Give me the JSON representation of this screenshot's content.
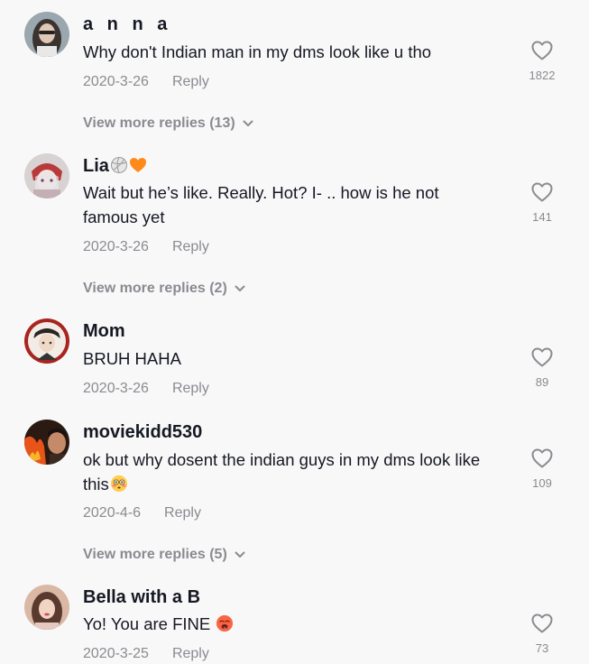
{
  "comments": [
    {
      "username": "a n n a",
      "text": "Why don't Indian man in my dms look like u tho",
      "emoji": "",
      "date": "2020-3-26",
      "reply_label": "Reply",
      "likes": "1822",
      "view_more": "View more replies (13)"
    },
    {
      "username": "Lia",
      "username_emoji": "volleyball-icon orange-heart-icon",
      "text": "Wait but he’s like. Really. Hot? I- .. how is he not famous yet",
      "emoji": "",
      "date": "2020-3-26",
      "reply_label": "Reply",
      "likes": "141",
      "view_more": "View more replies (2)"
    },
    {
      "username": "Mom",
      "text": "BRUH HAHA",
      "emoji": "",
      "date": "2020-3-26",
      "reply_label": "Reply",
      "likes": "89",
      "view_more": ""
    },
    {
      "username": "moviekidd530",
      "text": "ok but why dosent the indian guys in my dms look like this",
      "emoji": "flushed-face-icon",
      "date": "2020-4-6",
      "reply_label": "Reply",
      "likes": "109",
      "view_more": "View more replies (5)"
    },
    {
      "username": "Bella with a B",
      "text": "Yo! You are FINE",
      "emoji": "hot-face-icon",
      "date": "2020-3-25",
      "reply_label": "Reply",
      "likes": "73",
      "view_more": ""
    }
  ],
  "colors": {
    "background": "#f8f8f8",
    "primary_text": "#161823",
    "secondary_text": "#8a8b91"
  }
}
